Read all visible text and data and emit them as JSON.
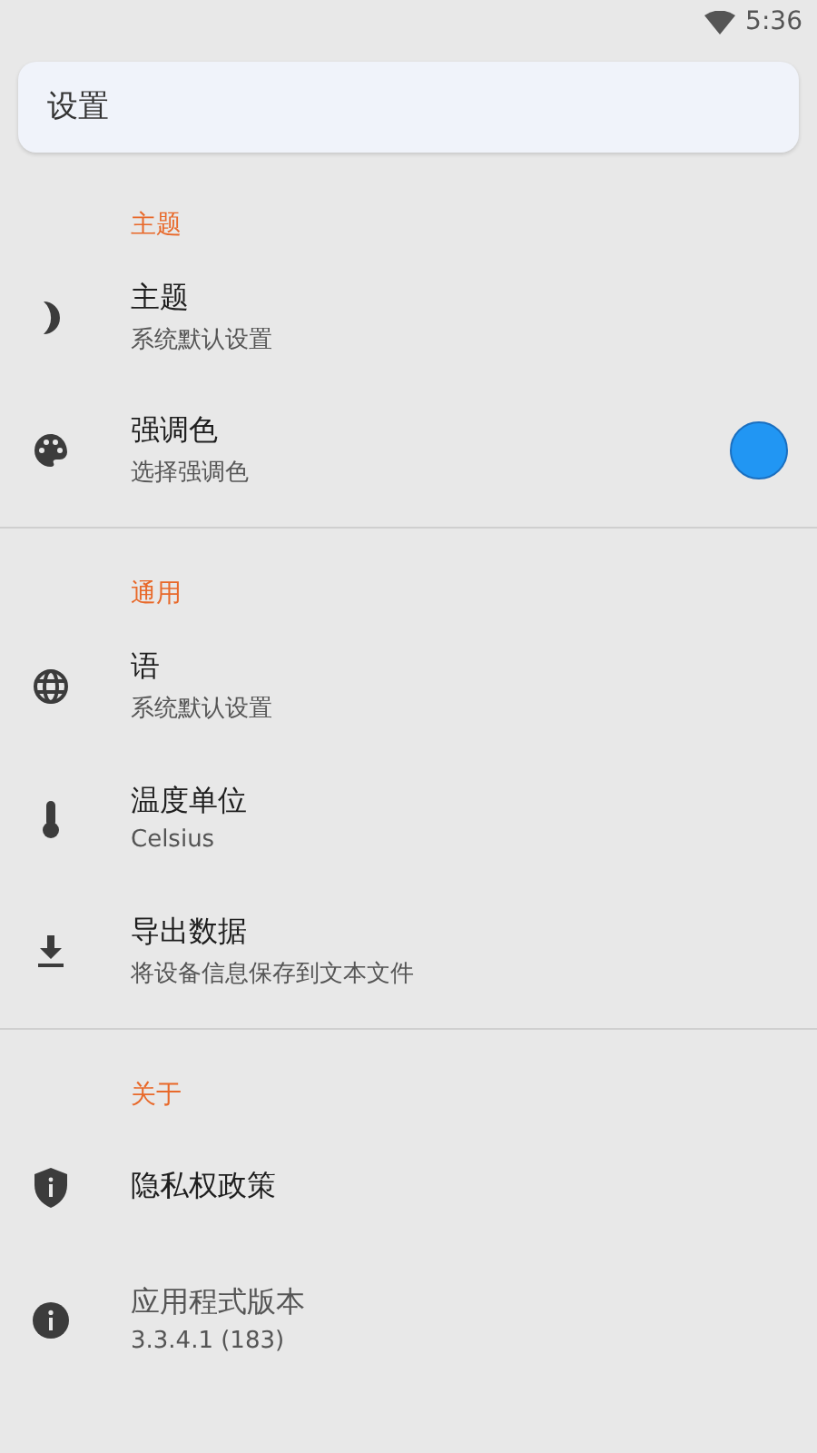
{
  "status_bar": {
    "time": "5:36"
  },
  "search": {
    "placeholder": "设置"
  },
  "sections": [
    {
      "header": "主题",
      "items": [
        {
          "title": "主题",
          "subtitle": "系统默认设置",
          "disabled": false
        },
        {
          "title": "强调色",
          "subtitle": "选择强调色",
          "disabled": false,
          "color": "#2196f3"
        }
      ]
    },
    {
      "header": "通用",
      "items": [
        {
          "title": "语",
          "subtitle": "系统默认设置",
          "disabled": false
        },
        {
          "title": "温度单位",
          "subtitle": "Celsius",
          "disabled": false
        },
        {
          "title": "导出数据",
          "subtitle": "将设备信息保存到文本文件",
          "disabled": false
        }
      ]
    },
    {
      "header": "关于",
      "items": [
        {
          "title": "隐私权政策",
          "disabled": false
        },
        {
          "title": "应用程式版本",
          "subtitle": "3.3.4.1 (183)",
          "disabled": true
        }
      ]
    }
  ]
}
